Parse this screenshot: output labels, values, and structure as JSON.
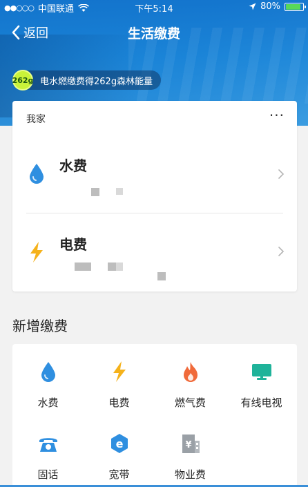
{
  "status_bar": {
    "signal_dots": "●●○○○",
    "carrier": "中国联通",
    "time": "下午5:14",
    "battery": "80%",
    "battery_level": 0.8
  },
  "nav": {
    "back_label": "返回",
    "title": "生活缴费"
  },
  "energy": {
    "badge": "262g",
    "text": "电水燃缴费得262g森林能量"
  },
  "home_card": {
    "label": "我家",
    "more": "···",
    "bills": [
      {
        "name": "水费",
        "icon": "water-drop-icon"
      },
      {
        "name": "电费",
        "icon": "lightning-icon"
      }
    ]
  },
  "new_payment": {
    "title": "新增缴费",
    "items": [
      {
        "label": "水费",
        "icon": "water-drop-icon"
      },
      {
        "label": "电费",
        "icon": "lightning-icon"
      },
      {
        "label": "燃气费",
        "icon": "flame-icon"
      },
      {
        "label": "有线电视",
        "icon": "tv-icon"
      },
      {
        "label": "固话",
        "icon": "telephone-icon"
      },
      {
        "label": "宽带",
        "icon": "broadband-icon"
      },
      {
        "label": "物业费",
        "icon": "property-building-icon"
      }
    ]
  },
  "colors": {
    "primary_blue": "#1a7fd6",
    "water": "#2f8fe0",
    "lightning": "#f5b21b",
    "flame": "#f06a3a",
    "tv": "#1fb39a",
    "property": "#9aa0a6",
    "energy_badge": "#c9f33a"
  }
}
